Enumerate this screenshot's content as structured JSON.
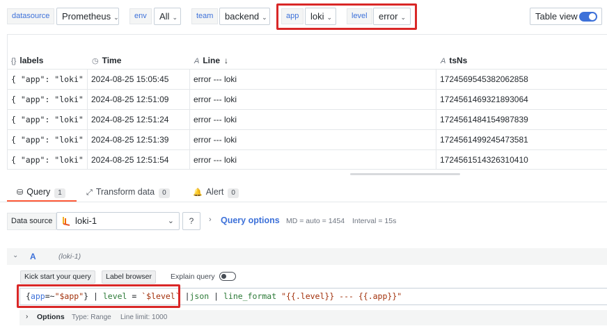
{
  "variables": [
    {
      "label": "datasource",
      "value": "Prometheus"
    },
    {
      "label": "env",
      "value": "All"
    },
    {
      "label": "team",
      "value": "backend"
    },
    {
      "label": "app",
      "value": "loki"
    },
    {
      "label": "level",
      "value": "error"
    }
  ],
  "table_view": {
    "label": "Table view",
    "enabled": true
  },
  "table": {
    "columns": [
      {
        "label": "labels",
        "icon": "{}"
      },
      {
        "label": "Time",
        "icon": "clock-icon"
      },
      {
        "label": "Line",
        "icon": "text-icon",
        "sort": "desc"
      },
      {
        "label": "tsNs",
        "icon": "text-icon"
      }
    ],
    "rows": [
      {
        "labels": "{ \"app\": \"loki\" }",
        "time": "2024-08-25 15:05:45",
        "line": "error --- loki",
        "tsns": "1724569545382062858"
      },
      {
        "labels": "{ \"app\": \"loki\" }",
        "time": "2024-08-25 12:51:09",
        "line": "error --- loki",
        "tsns": "1724561469321893064"
      },
      {
        "labels": "{ \"app\": \"loki\" }",
        "time": "2024-08-25 12:51:24",
        "line": "error --- loki",
        "tsns": "1724561484154987839"
      },
      {
        "labels": "{ \"app\": \"loki\" }",
        "time": "2024-08-25 12:51:39",
        "line": "error --- loki",
        "tsns": "1724561499245473581"
      },
      {
        "labels": "{ \"app\": \"loki\" }",
        "time": "2024-08-25 12:51:54",
        "line": "error --- loki",
        "tsns": "1724561514326310410"
      }
    ]
  },
  "tabs": [
    {
      "label": "Query",
      "count": "1",
      "active": true
    },
    {
      "label": "Transform data",
      "count": "0"
    },
    {
      "label": "Alert",
      "count": "0"
    }
  ],
  "datasource_row": {
    "label": "Data source",
    "selected": "loki-1",
    "help": "?",
    "query_options_label": "Query options",
    "md": "MD = auto = 1454",
    "interval": "Interval = 15s"
  },
  "query_a": {
    "name": "A",
    "datasource": "(loki-1)",
    "kick_start": "Kick start your query",
    "label_browser": "Label browser",
    "explain": "Explain query",
    "expr": {
      "open": "{",
      "label": "app",
      "op": "=~",
      "value": "\"$app\"",
      "close": "}",
      "pipe1": " | ",
      "level_kw": "level",
      "eq": " = ",
      "level_val": "`$level`",
      "rest_pipe": " |",
      "json": "json",
      "pipe3": " | ",
      "lf": "line_format",
      "lf_arg": " \"{{.level}} --- {{.app}}\""
    },
    "options": {
      "label": "Options",
      "type": "Type: Range",
      "limit": "Line limit: 1000"
    }
  },
  "colors": {
    "accent": "#3d71d9",
    "highlight": "#d92727",
    "active_tab": "#ff5a38"
  }
}
